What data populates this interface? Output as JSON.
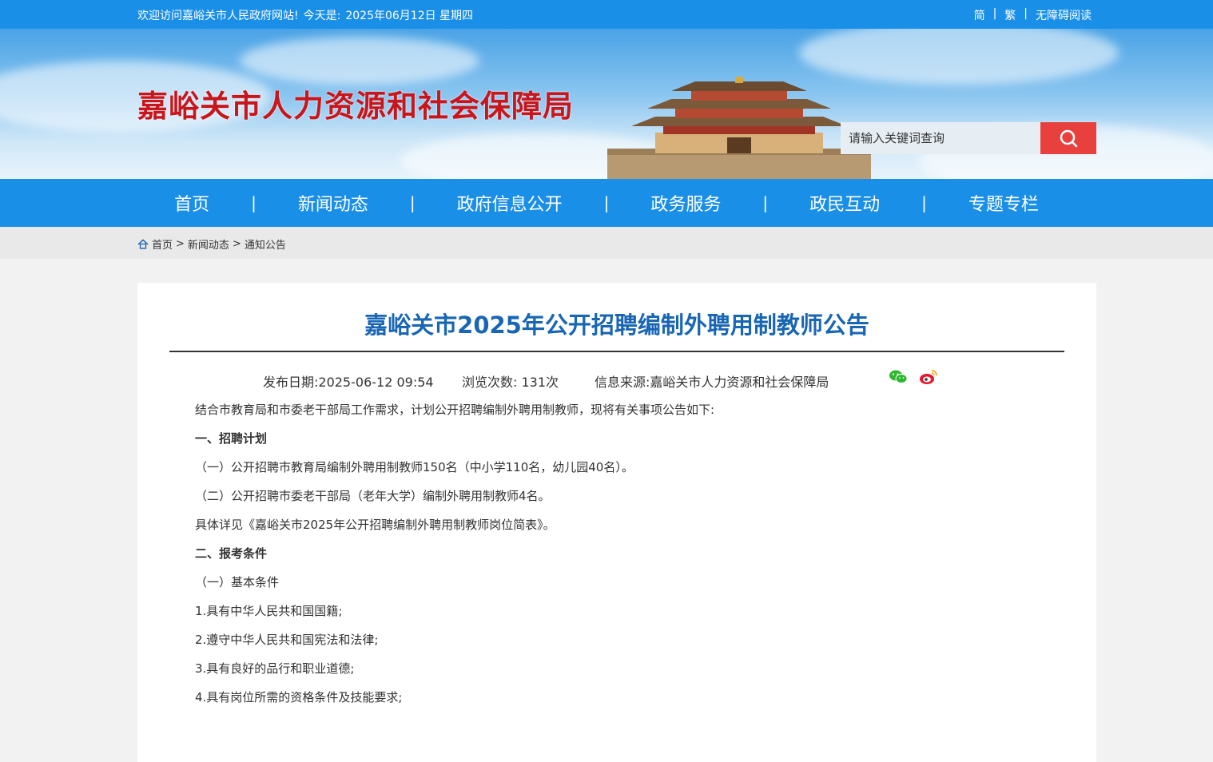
{
  "topbar": {
    "welcome": "欢迎访问嘉峪关市人民政府网站!",
    "today_label": "今天是:",
    "date": "2025年06月12日 星期四",
    "links": [
      "简",
      "繁",
      "无障碍阅读"
    ],
    "sep": "|"
  },
  "header": {
    "site_title": "嘉峪关市人力资源和社会保障局",
    "search_placeholder": "请输入关键词查询"
  },
  "nav": {
    "items": [
      "首页",
      "新闻动态",
      "政府信息公开",
      "政务服务",
      "政民互动",
      "专题专栏"
    ],
    "sep": "|"
  },
  "breadcrumb": [
    "首页",
    "新闻动态",
    "通知公告"
  ],
  "breadcrumb_sep": ">",
  "article": {
    "title": "嘉峪关市2025年公开招聘编制外聘用制教师公告",
    "publish": "发布日期:2025-06-12 09:54",
    "views": "浏览次数: 131次",
    "source": "信息来源:嘉峪关市人力资源和社会保障局",
    "paragraphs": [
      "结合市教育局和市委老干部局工作需求，计划公开招聘编制外聘用制教师，现将有关事项公告如下:",
      "一、招聘计划",
      "（一）公开招聘市教育局编制外聘用制教师150名（中小学110名，幼儿园40名）。",
      "（二）公开招聘市委老干部局（老年大学）编制外聘用制教师4名。",
      "具体详见《嘉峪关市2025年公开招聘编制外聘用制教师岗位简表》。",
      "二、报考条件",
      "（一）基本条件",
      "1.具有中华人民共和国国籍;",
      "2.遵守中华人民共和国宪法和法律;",
      "3.具有良好的品行和职业道德;",
      "4.具有岗位所需的资格条件及技能要求;"
    ]
  },
  "colors": {
    "primary": "#1a8fe8",
    "title_red": "#c8161d",
    "search_btn": "#e8413d",
    "article_title": "#1866b4"
  },
  "icons": [
    "home-icon",
    "search-icon",
    "wechat-icon",
    "weibo-icon"
  ]
}
